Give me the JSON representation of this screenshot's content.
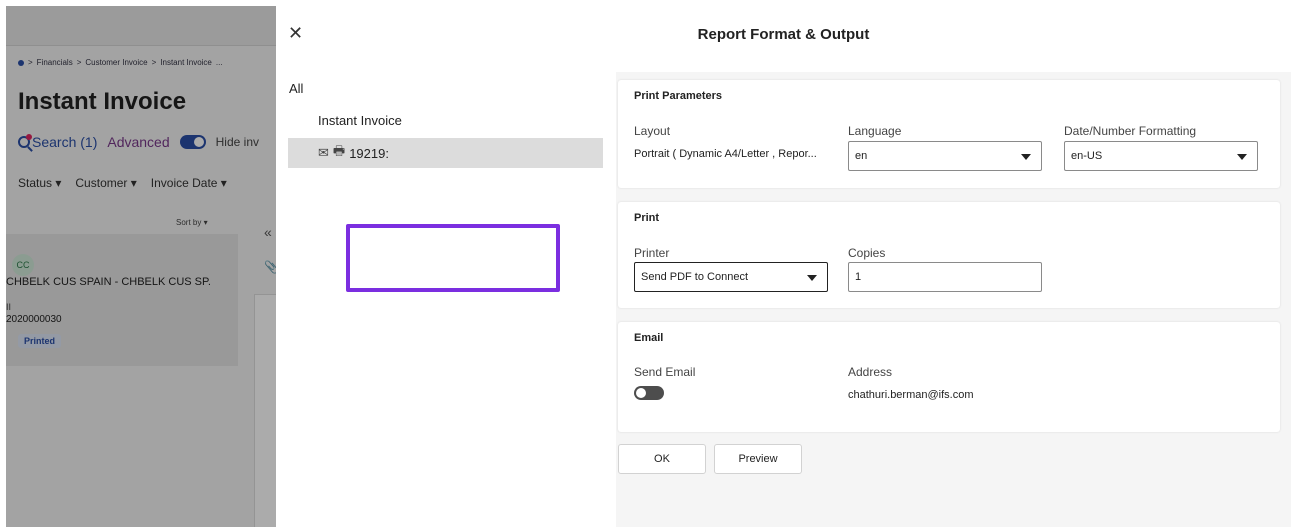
{
  "background": {
    "breadcrumb": [
      "Financials",
      "Customer Invoice",
      "Instant Invoice",
      "..."
    ],
    "page_title": "Instant Invoice",
    "search_label": "Search (1)",
    "advanced_label": "Advanced",
    "hide_label": "Hide inv",
    "filters": [
      "Status",
      "Customer",
      "Invoice Date"
    ],
    "sort_by": "Sort by",
    "card": {
      "avatar": "CC",
      "customer": "CHBELK CUS SPAIN - CHBELK CUS SP.",
      "type": "II",
      "number": "2020000030",
      "status": "Printed"
    }
  },
  "dialog": {
    "close_icon": "close-icon",
    "title": "Report Format & Output",
    "tree": {
      "all": "All",
      "report": "Instant Invoice",
      "selected_item": "19219:"
    },
    "print_parameters": {
      "title": "Print Parameters",
      "layout_label": "Layout",
      "layout_value": "Portrait ( Dynamic A4/Letter , Repor...",
      "language_label": "Language",
      "language_value": "en",
      "format_label": "Date/Number Formatting",
      "format_value": "en-US"
    },
    "print": {
      "title": "Print",
      "printer_label": "Printer",
      "printer_value": "Send PDF to Connect",
      "copies_label": "Copies",
      "copies_value": "1"
    },
    "email": {
      "title": "Email",
      "send_label": "Send Email",
      "send_enabled": false,
      "address_label": "Address",
      "address_value": "chathuri.berman@ifs.com"
    },
    "buttons": {
      "ok": "OK",
      "preview": "Preview"
    },
    "highlight_color": "#7b2ee0"
  }
}
